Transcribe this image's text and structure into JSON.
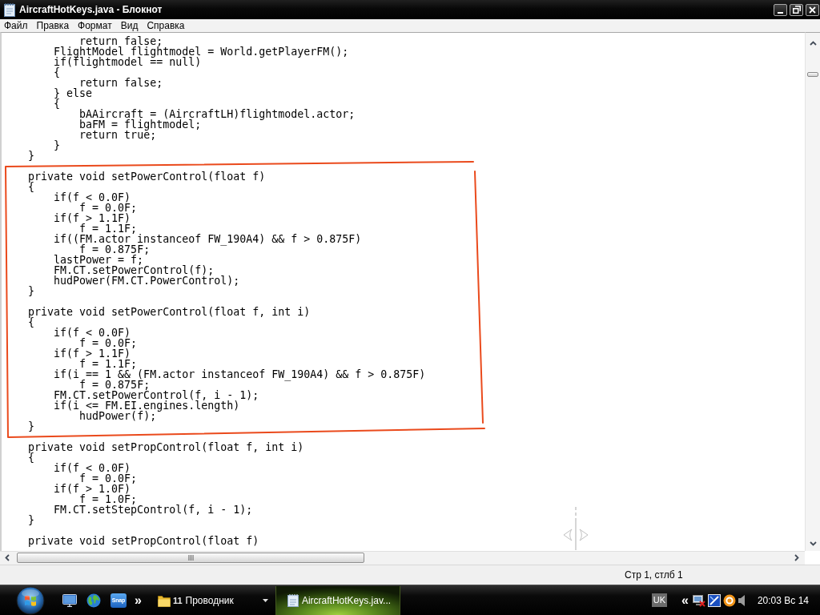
{
  "window": {
    "title": "AircraftHotKeys.java - Блокнот"
  },
  "menu": [
    "Файл",
    "Правка",
    "Формат",
    "Вид",
    "Справка"
  ],
  "editor": {
    "blocks": [
      {
        "lines": [
          "            return false;",
          "        FlightModel flightmodel = World.getPlayerFM();",
          "        if(flightmodel == null)",
          "        {",
          "            return false;",
          "        } else",
          "        {",
          "            bAAircraft = (AircraftLH)flightmodel.actor;",
          "            baFM = flightmodel;",
          "            return true;",
          "        }",
          "    }"
        ]
      },
      {
        "lines": [
          "    private void setPowerControl(float f)",
          "    {",
          "        if(f < 0.0F)",
          "            f = 0.0F;",
          "        if(f > 1.1F)",
          "            f = 1.1F;",
          "        if((FM.actor instanceof FW_190A4) && f > 0.875F)",
          "            f = 0.875F;",
          "        lastPower = f;",
          "        FM.CT.setPowerControl(f);",
          "        hudPower(FM.CT.PowerControl);",
          "    }"
        ]
      },
      {
        "lines": [
          "    private void setPowerControl(float f, int i)",
          "    {",
          "        if(f < 0.0F)",
          "            f = 0.0F;",
          "        if(f > 1.1F)",
          "            f = 1.1F;",
          "        if(i == 1 && (FM.actor instanceof FW_190A4) && f > 0.875F)",
          "            f = 0.875F;",
          "        FM.CT.setPowerControl(f, i - 1);",
          "        if(i <= FM.EI.engines.length)",
          "            hudPower(f);",
          "    }"
        ]
      },
      {
        "lines": [
          "    private void setPropControl(float f, int i)",
          "    {",
          "        if(f < 0.0F)",
          "            f = 0.0F;",
          "        if(f > 1.0F)",
          "            f = 1.0F;",
          "        FM.CT.setStepControl(f, i - 1);",
          "    }"
        ]
      },
      {
        "lines": [
          "    private void setPropControl(float f)"
        ]
      }
    ]
  },
  "status_bar": {
    "position": "Стр 1, стлб 1"
  },
  "taskbar": {
    "quick_launch": {
      "app_label": "Snap",
      "more": "»"
    },
    "tasks": [
      {
        "kind": "group",
        "count": "11",
        "label": "Проводник",
        "selected": false
      },
      {
        "kind": "window",
        "label": "AircraftHotKeys.jav...",
        "selected": true
      }
    ],
    "tray": {
      "language": "UK",
      "expand": "«",
      "clock": "20:03 Вс 14"
    }
  }
}
